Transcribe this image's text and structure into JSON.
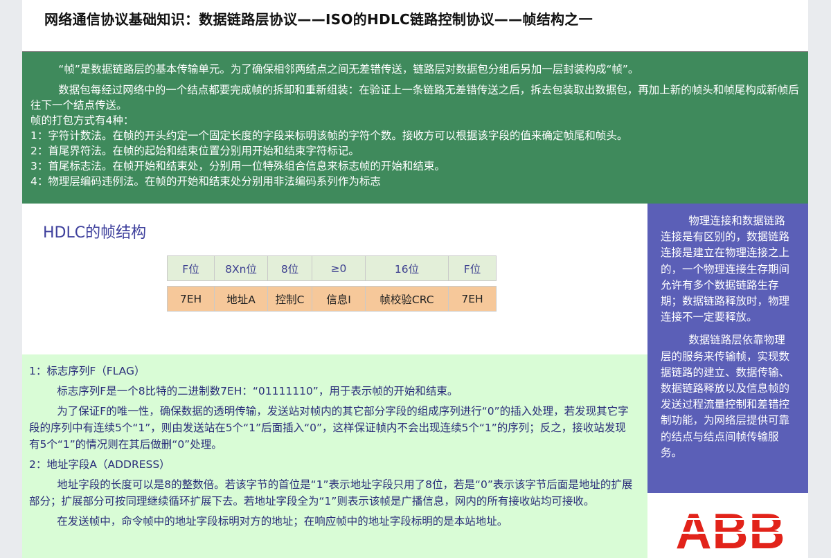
{
  "title": "网络通信协议基础知识：数据链路层协议——ISO的HDLC链路控制协议——帧结构之一",
  "intro": {
    "p1": "“帧”是数据链路层的基本传输单元。为了确保相邻两结点之间无差错传送，链路层对数据包分组后另加一层封装构成“帧”。",
    "p2": "数据包每经过网络中的一个结点都要完成帧的拆卸和重新组装：在验证上一条链路无差错传送之后，拆去包装取出数据包，再加上新的帧头和帧尾构成新帧后往下一个结点传送。",
    "p3": "帧的打包方式有4种：",
    "items": [
      "1：字符计数法。在帧的开头约定一个固定长度的字段来标明该帧的字符个数。接收方可以根据该字段的值来确定帧尾和帧头。",
      "2：首尾界符法。在帧的起始和结束位置分别用开始和结束字符标记。",
      "3：首尾标志法。在帧开始和结束处，分别用一位特殊组合信息来标志帧的开始和结束。",
      "4：物理层编码违例法。在帧的开始和结束处分别用非法编码系列作为标志"
    ]
  },
  "hdlc": {
    "title": "HDLC的帧结构",
    "bits": [
      "F位",
      "8Xn位",
      "8位",
      "≥0",
      "16位",
      "F位"
    ],
    "fields": [
      "7EH",
      "地址A",
      "控制C",
      "信息I",
      "帧校验CRC",
      "7EH"
    ]
  },
  "explain": {
    "h1": "1：标志序列F（FLAG）",
    "p1": "标志序列F是一个8比特的二进制数7EH：“01111110”，用于表示帧的开始和结束。",
    "p2": "为了保证F的唯一性，确保数据的透明传输，发送站对帧内的其它部分字段的组成序列进行“0”的插入处理，若发现其它字段的序列中有连续5个“1”，则由发送站在5个“1”后面插入“0”，这样保证帧内不会出现连续5个“1”的序列；反之，接收站发现有5个“1”的情况则在其后做删“0”处理。",
    "h2": "2：地址字段A（ADDRESS）",
    "p3": "地址字段的长度可以是8的整数倍。若该字节的首位是“1”表示地址字段只用了8位，若是“0”表示该字节后面是地址的扩展部分；扩展部分可按同理继续循环扩展下去。若地址字段全为“1”则表示该帧是广播信息，网内的所有接收站均可接收。",
    "p4": "在发送帧中，命令帧中的地址字段标明对方的地址；在响应帧中的地址字段标明的是本站地址。"
  },
  "sidebar": {
    "p1": "物理连接和数据链路连接是有区别的，数据链路连接是建立在物理连接之上的，一个物理连接生存期间允许有多个数据链路生存期；数据链路释放时，物理连接不一定要释放。",
    "p2": "数据链路层依靠物理层的服务来传输帧，实现数据链路的建立、数据传输、数据链路释放以及信息帧的发送过程流量控制和差错控制功能，为网络层提供可靠的结点与结点间帧传输服务。"
  },
  "logo": {
    "text": "ABB",
    "color": "#e2231a"
  }
}
